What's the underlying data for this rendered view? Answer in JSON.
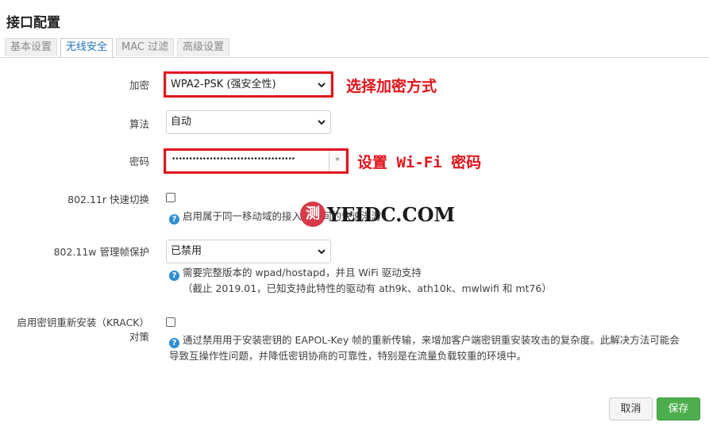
{
  "page_title": "接口配置",
  "tabs": [
    {
      "label": "基本设置",
      "active": false
    },
    {
      "label": "无线安全",
      "active": true
    },
    {
      "label": "MAC 过滤",
      "active": false
    },
    {
      "label": "高级设置",
      "active": false
    }
  ],
  "fields": {
    "encryption": {
      "label": "加密",
      "value": "WPA2-PSK (强安全性)"
    },
    "cipher": {
      "label": "算法",
      "value": "自动"
    },
    "password": {
      "label": "密码",
      "masked_value": "••••••••••••••••••••••••••••••••••••",
      "reveal_glyph": "*"
    },
    "ft": {
      "label": "802.11r 快速切换",
      "help": "启用属于同一移动域的接入点之间的快速漫游"
    },
    "mfp": {
      "label": "802.11w 管理帧保护",
      "value": "已禁用",
      "help_line1": "需要完整版本的 wpad/hostapd，并且 WiFi 驱动支持",
      "help_line2": "（截止 2019.01，已知支持此特性的驱动有 ath9k、ath10k、mwlwifi 和 mt76）"
    },
    "krack": {
      "label_line1": "启用密钥重新安装（KRACK）",
      "label_line2": "对策",
      "help_line1": "通过禁用用于安装密钥的 EAPOL-Key 帧的重新传输，来增加客户端密钥重安装攻击的复杂度。此解决方法可能会",
      "help_line2": "导致互操作性问题，并降低密钥协商的可靠性，特别是在流量负载较重的环境中。"
    }
  },
  "annotations": {
    "encryption_note": "选择加密方式",
    "password_note": "设置 Wi-Fi 密码"
  },
  "watermark": {
    "glyph": "测",
    "text": "YEIDC.COM"
  },
  "buttons": {
    "cancel": "取消",
    "save": "保存"
  },
  "colors": {
    "accent_red": "#e0141b",
    "save_green": "#4cae4c",
    "tab_active": "#1f72b8",
    "help_blue": "#2f8fd0"
  }
}
